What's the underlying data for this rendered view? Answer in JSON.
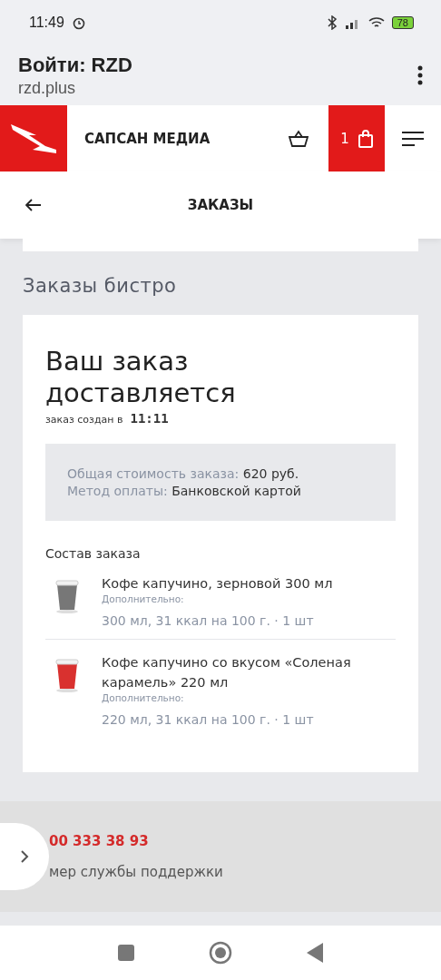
{
  "status_bar": {
    "time": "11:49",
    "battery": "78"
  },
  "browser": {
    "title": "Войти: RZD",
    "url": "rzd.plus"
  },
  "site_header": {
    "brand": "САПСАН МЕДИА",
    "cart_count": "1"
  },
  "subheader": {
    "title": "ЗАКАЗЫ"
  },
  "section_title": "Заказы бистро",
  "order": {
    "title": "Ваш заказ доставляется",
    "created_label": "заказ создан в",
    "created_time": "11:11",
    "summary": [
      {
        "label": "Общая стоимость заказа:",
        "value": "620 руб."
      },
      {
        "label": "Метод оплаты:",
        "value": "Банковской картой"
      }
    ],
    "items_title": "Состав заказа",
    "items": [
      {
        "name": "Кофе капучино, зерновой 300 мл",
        "extra": "Дополнительно:",
        "details": "300 мл, 31 ккал на 100 г. · 1 шт",
        "color": "#777777"
      },
      {
        "name": "Кофе капучино со вкусом «Соленая карамель» 220 мл",
        "extra": "Дополнительно:",
        "details": "220 мл, 31 ккал на 100 г. · 1 шт",
        "color": "#d9312f"
      }
    ]
  },
  "footer": {
    "phone": "00 333 38 93",
    "caption": "мер службы поддержки"
  }
}
